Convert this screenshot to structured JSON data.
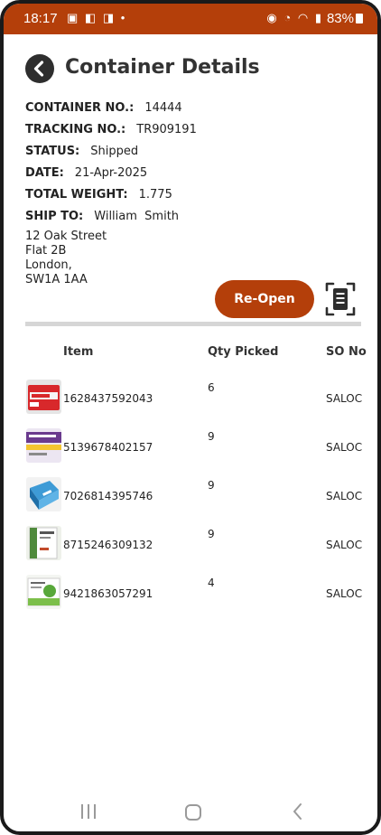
{
  "status_bar": {
    "time": "18:17",
    "left_icons": [
      "image-icon",
      "outlook-icon",
      "teams-icon",
      "dot-icon"
    ],
    "right_icons": [
      "alarm-icon",
      "clock-icon",
      "wifi-icon",
      "signal-icon",
      "volte-icon"
    ],
    "battery": "83%",
    "color": "#b43f0a"
  },
  "header": {
    "title": "Container Details"
  },
  "details": [
    {
      "label": "CONTAINER NO.:",
      "value": "14444"
    },
    {
      "label": "TRACKING NO.:",
      "value": "TR909191"
    },
    {
      "label": "STATUS:",
      "value": "Shipped"
    },
    {
      "label": "DATE:",
      "value": "21-Apr-2025"
    },
    {
      "label": "TOTAL WEIGHT:",
      "value": "1.775"
    },
    {
      "label": "SHIP TO:",
      "value": "William  Smith"
    }
  ],
  "address": {
    "line1": "12 Oak Street",
    "line2": "Flat 2B",
    "line3": "London,",
    "line4": "SW1A 1AA"
  },
  "actions": {
    "reopen_label": "Re-Open",
    "scan_icon": "document-scan-icon",
    "accent": "#b43f0a"
  },
  "table": {
    "headers": {
      "item": "Item",
      "qty": "Qty Picked",
      "so": "SO No"
    },
    "rows": [
      {
        "code": "1628437592043",
        "qty": "6",
        "so": "SALOC",
        "thumb": "ibuprofen-box"
      },
      {
        "code": "5139678402157",
        "qty": "9",
        "so": "SALOC",
        "thumb": "tablets-box"
      },
      {
        "code": "7026814395746",
        "qty": "9",
        "so": "SALOC",
        "thumb": "blue-box"
      },
      {
        "code": "8715246309132",
        "qty": "9",
        "so": "SALOC",
        "thumb": "green-box"
      },
      {
        "code": "9421863057291",
        "qty": "4",
        "so": "SALOC",
        "thumb": "white-green-box"
      }
    ]
  }
}
